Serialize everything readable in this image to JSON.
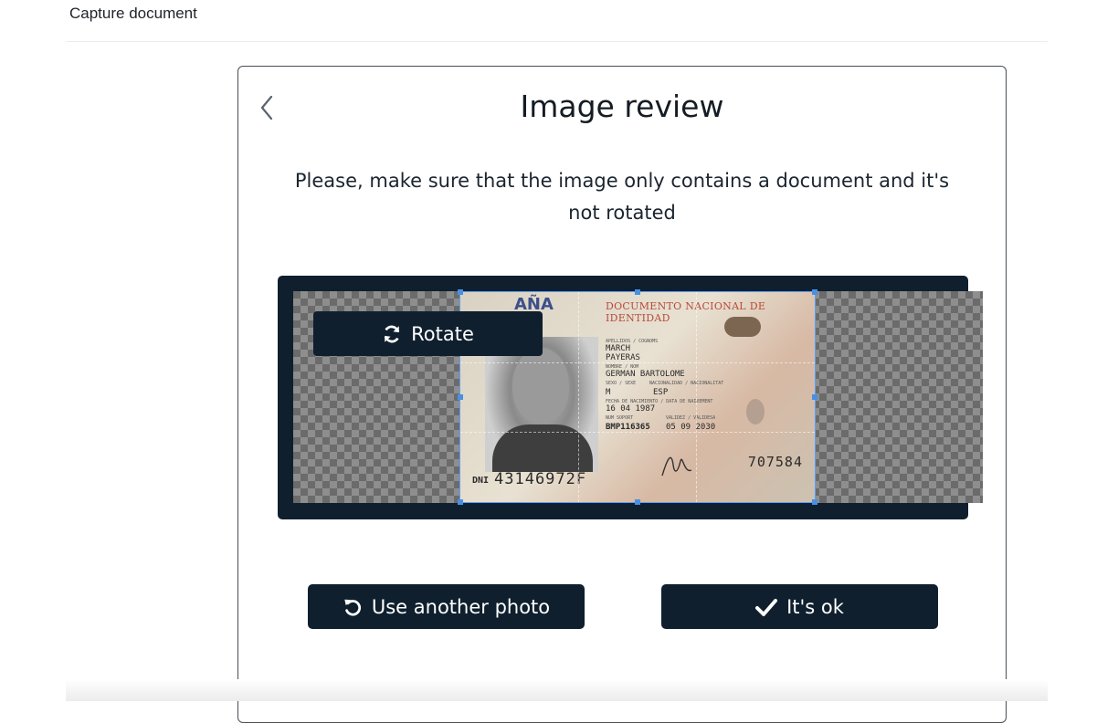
{
  "header": {
    "title": "Capture document"
  },
  "review": {
    "title": "Image review",
    "instructions": "Please, make sure that the image only contains a document and it's not rotated",
    "rotate_label": "Rotate",
    "buttons": {
      "another_label": "Use another photo",
      "ok_label": "It's ok"
    }
  },
  "document": {
    "country": "AÑA",
    "doc_type": "DOCUMENTO NACIONAL DE IDENTIDAD",
    "surnames_label": "APELLIDOS / COGNOMS",
    "surname_1": "MARCH",
    "surname_2": "PAYERAS",
    "name_label": "NOMBRE / NOM",
    "name": "GERMAN BARTOLOME",
    "sex_label": "SEXO / SEXE",
    "sex": "M",
    "nationality_label": "NACIONALIDAD / NACIONALITAT",
    "nationality": "ESP",
    "birth_label": "FECHA DE NACIMIENTO / DATA DE NAIXEMENT",
    "birth_date": "16 04 1987",
    "support_label": "NUM SOPORT",
    "support_number": "BMP116365",
    "validity_label": "VALIDEZ / VALIDESA",
    "validity": "05 09 2030",
    "dni_label": "DNI",
    "dni_number": "43146972F",
    "can_number": "707584"
  },
  "icons": {
    "back": "chevron-left-icon",
    "rotate": "sync-icon",
    "another": "undo-icon",
    "ok": "check-icon"
  },
  "colors": {
    "dark": "#0f1f2e",
    "crop_accent": "#4a90e2"
  }
}
